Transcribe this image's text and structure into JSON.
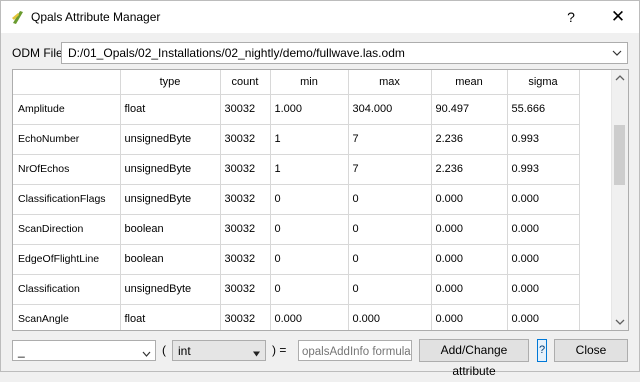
{
  "window": {
    "title": "Qpals Attribute Manager",
    "help_label": "?",
    "close_label": "✕"
  },
  "odm": {
    "label": "ODM File",
    "value": "D:/01_Opals/02_Installations/02_nightly/demo/fullwave.las.odm"
  },
  "table": {
    "columns": [
      "type",
      "count",
      "min",
      "max",
      "mean",
      "sigma"
    ],
    "rows": [
      {
        "name": "Amplitude",
        "cells": [
          "float",
          "30032",
          "1.000",
          "304.000",
          "90.497",
          "55.666"
        ]
      },
      {
        "name": "EchoNumber",
        "cells": [
          "unsignedByte",
          "30032",
          "1",
          "7",
          "2.236",
          "0.993"
        ]
      },
      {
        "name": "NrOfEchos",
        "cells": [
          "unsignedByte",
          "30032",
          "1",
          "7",
          "2.236",
          "0.993"
        ]
      },
      {
        "name": "ClassificationFlags",
        "cells": [
          "unsignedByte",
          "30032",
          "0",
          "0",
          "0.000",
          "0.000"
        ]
      },
      {
        "name": "ScanDirection",
        "cells": [
          "boolean",
          "30032",
          "0",
          "0",
          "0.000",
          "0.000"
        ]
      },
      {
        "name": "EdgeOfFlightLine",
        "cells": [
          "boolean",
          "30032",
          "0",
          "0",
          "0.000",
          "0.000"
        ]
      },
      {
        "name": "Classification",
        "cells": [
          "unsignedByte",
          "30032",
          "0",
          "0",
          "0.000",
          "0.000"
        ]
      },
      {
        "name": "ScanAngle",
        "cells": [
          "float",
          "30032",
          "0.000",
          "0.000",
          "0.000",
          "0.000"
        ]
      }
    ]
  },
  "bottom": {
    "attr_value": "_",
    "open_paren": "(",
    "type_value": "int",
    "close_paren_eq": ") =",
    "formula_placeholder": "opalsAddInfo formula",
    "add_button": "Add/Change attribute",
    "help_button": "?",
    "close_button": "Close"
  },
  "colors": {
    "border": "#adadad",
    "accent": "#0078d7",
    "icon_green": "#6a9b2f",
    "icon_yellow": "#e2c43b"
  }
}
